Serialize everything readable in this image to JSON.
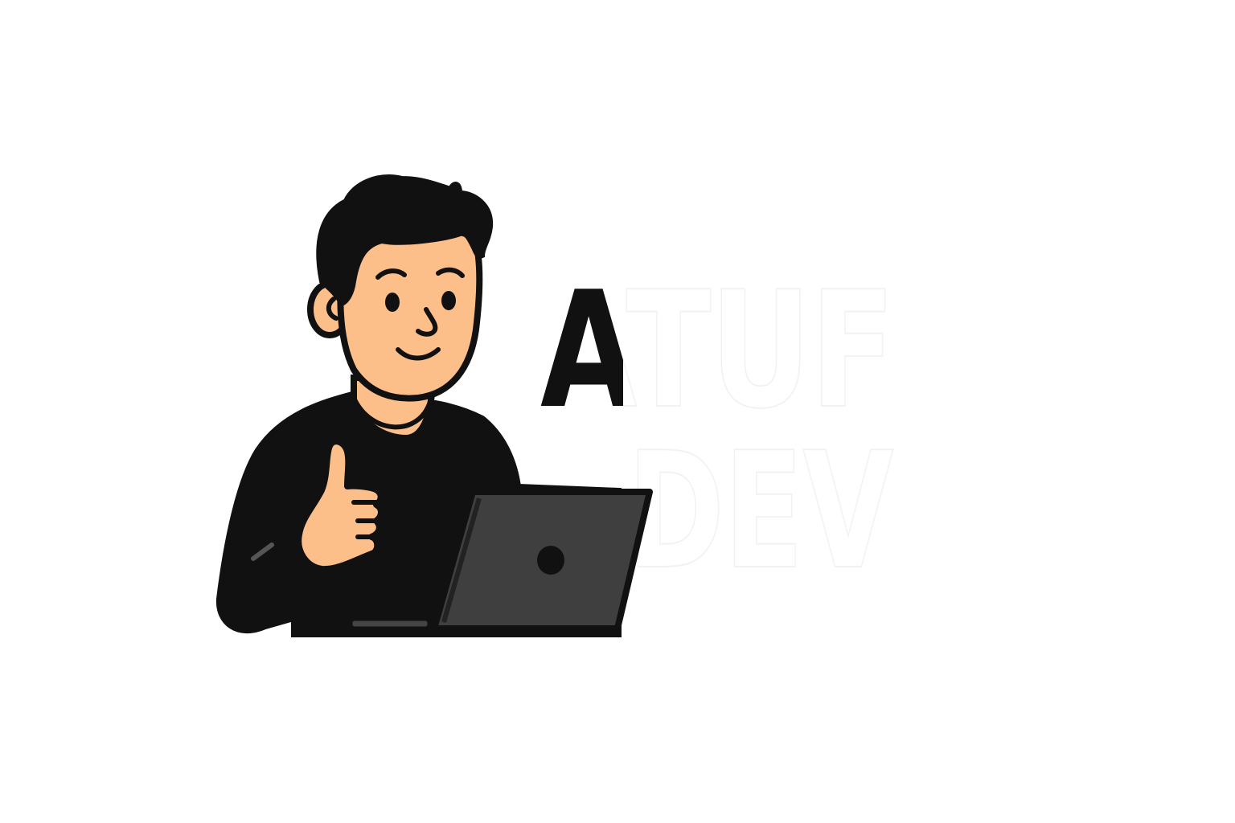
{
  "logo": {
    "line1": "ATUF",
    "line2": "DEV"
  },
  "illustration": {
    "figure": "developer-thumbs-up",
    "icons": [
      "laptop-icon",
      "thumbs-up-icon"
    ]
  },
  "colors": {
    "background": "#ffffff",
    "ink": "#111111",
    "skin": "#fcbf8a",
    "laptop": "#3f3f3f",
    "text_overlay": "#ffffff"
  }
}
